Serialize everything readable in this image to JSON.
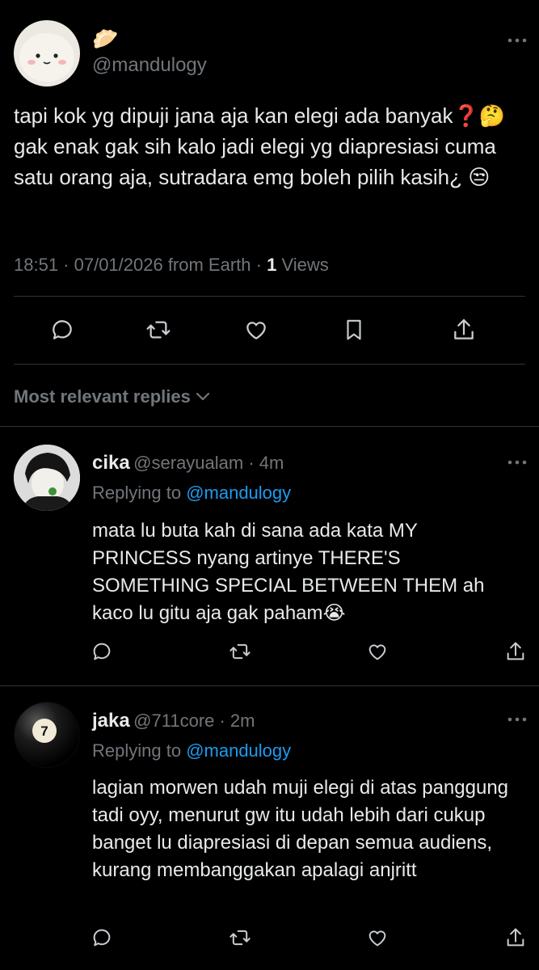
{
  "tweet": {
    "author_emoji": "🥟",
    "handle": "@mandulogy",
    "text": "tapi kok yg dipuji jana aja kan elegi ada banyak❓🤔 gak enak gak sih kalo jadi elegi yg diapresiasi cuma satu orang aja, sutradara emg boleh pilih kasih¿ 😒",
    "meta_time": "18:51 · 07/01/2026 from Earth · ",
    "views_count": "1",
    "views_label": " Views"
  },
  "actions": {
    "icons": [
      "comment-icon",
      "retweet-icon",
      "heart-icon",
      "bookmark-icon",
      "share-icon"
    ]
  },
  "filter": {
    "label": "Most relevant replies"
  },
  "replies": [
    {
      "name": "cika",
      "handle": "@serayualam",
      "time": " · 4m",
      "replying_prefix": "Replying to ",
      "replying_to": "@mandulogy",
      "text": "mata lu buta kah di sana ada kata MY PRINCESS nyang artinye THERE'S SOMETHING SPECIAL BETWEEN THEM ah kaco lu gitu aja gak paham😭"
    },
    {
      "name": "jaka",
      "handle": "@711core",
      "time": " · 2m",
      "replying_prefix": "Replying to ",
      "replying_to": "@mandulogy",
      "text": "lagian morwen udah muji elegi di atas panggung tadi oyy, menurut gw itu udah lebih dari cukup banget lu diapresiasi di depan semua audiens, kurang membanggakan apalagi anjritt"
    }
  ],
  "avatar_badge": "7",
  "colors": {
    "background": "#000000",
    "text": "#e7e9ea",
    "muted": "#71767b",
    "accent": "#1d9bf0",
    "divider": "#2f3336"
  }
}
